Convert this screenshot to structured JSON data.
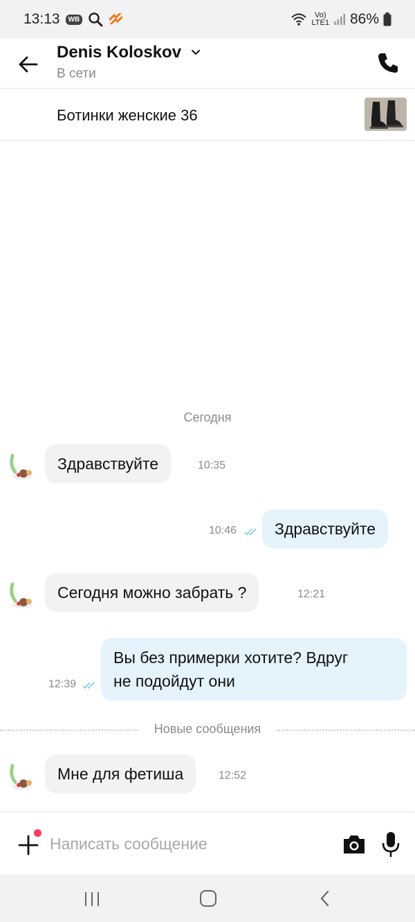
{
  "status_bar": {
    "time": "13:13",
    "wb_badge": "WB",
    "network_top": "Vo)",
    "network_bottom": "LTE1",
    "battery": "86%"
  },
  "header": {
    "name": "Denis Koloskov",
    "status": "В сети"
  },
  "product": {
    "title": "Ботинки женские 36"
  },
  "chat": {
    "date_separator": "Сегодня",
    "new_messages_label": "Новые сообщения",
    "messages": [
      {
        "direction": "in",
        "text": "Здравствуйте",
        "time": "10:35"
      },
      {
        "direction": "out",
        "text": "Здравствуйте",
        "time": "10:46"
      },
      {
        "direction": "in",
        "text": "Сегодня можно забрать ?",
        "time": "12:21"
      },
      {
        "direction": "out",
        "text_line1": "Вы без примерки  хотите? Вдруг",
        "text_line2": "не подойдут  они",
        "time": "12:39"
      },
      {
        "direction": "in",
        "text": "Мне для фетиша",
        "time": "12:52"
      }
    ]
  },
  "composer": {
    "placeholder": "Написать сообщение"
  },
  "colors": {
    "incoming_bubble": "#f2f2f4",
    "outgoing_bubble": "#e4f3fc",
    "read_ticks": "#7fc4ec",
    "badge_dot": "#ff3b5c"
  },
  "icons": [
    "back-arrow-icon",
    "chevron-down-icon",
    "phone-icon",
    "plus-icon",
    "camera-icon",
    "microphone-icon",
    "double-check-icon",
    "wifi-icon",
    "signal-icon",
    "battery-icon",
    "search-icon"
  ]
}
